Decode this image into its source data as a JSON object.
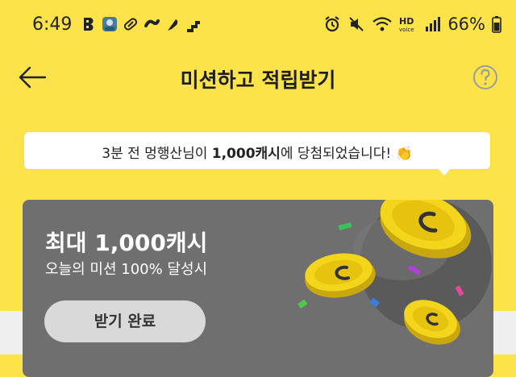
{
  "status_bar": {
    "time": "6:49",
    "battery_percent": "66%",
    "notification_icons": [
      "b-app-icon",
      "avatar-icon",
      "pill-icon",
      "link-icon",
      "feather-icon",
      "stairs-icon"
    ],
    "system_icons": [
      "alarm-icon",
      "mute-icon",
      "wifi-icon",
      "hd-voice-icon",
      "signal-icon",
      "battery-icon"
    ]
  },
  "header": {
    "title": "미션하고 적립받기",
    "back_icon": "back-arrow-icon",
    "help_icon": "help-icon"
  },
  "toast": {
    "prefix": "3분 전 멍행산님이 ",
    "amount": "1,000캐시",
    "suffix": "에 당첨되었습니다!",
    "emoji": "👏"
  },
  "reward_card": {
    "title": "최대 1,000캐시",
    "subtitle": "오늘의 미션 100% 달성시",
    "button_label": "받기 완료"
  },
  "colors": {
    "background": "#fde34a",
    "card": "#6f6f6f",
    "coin": "#f2d21b",
    "button": "#d9d9d9"
  }
}
